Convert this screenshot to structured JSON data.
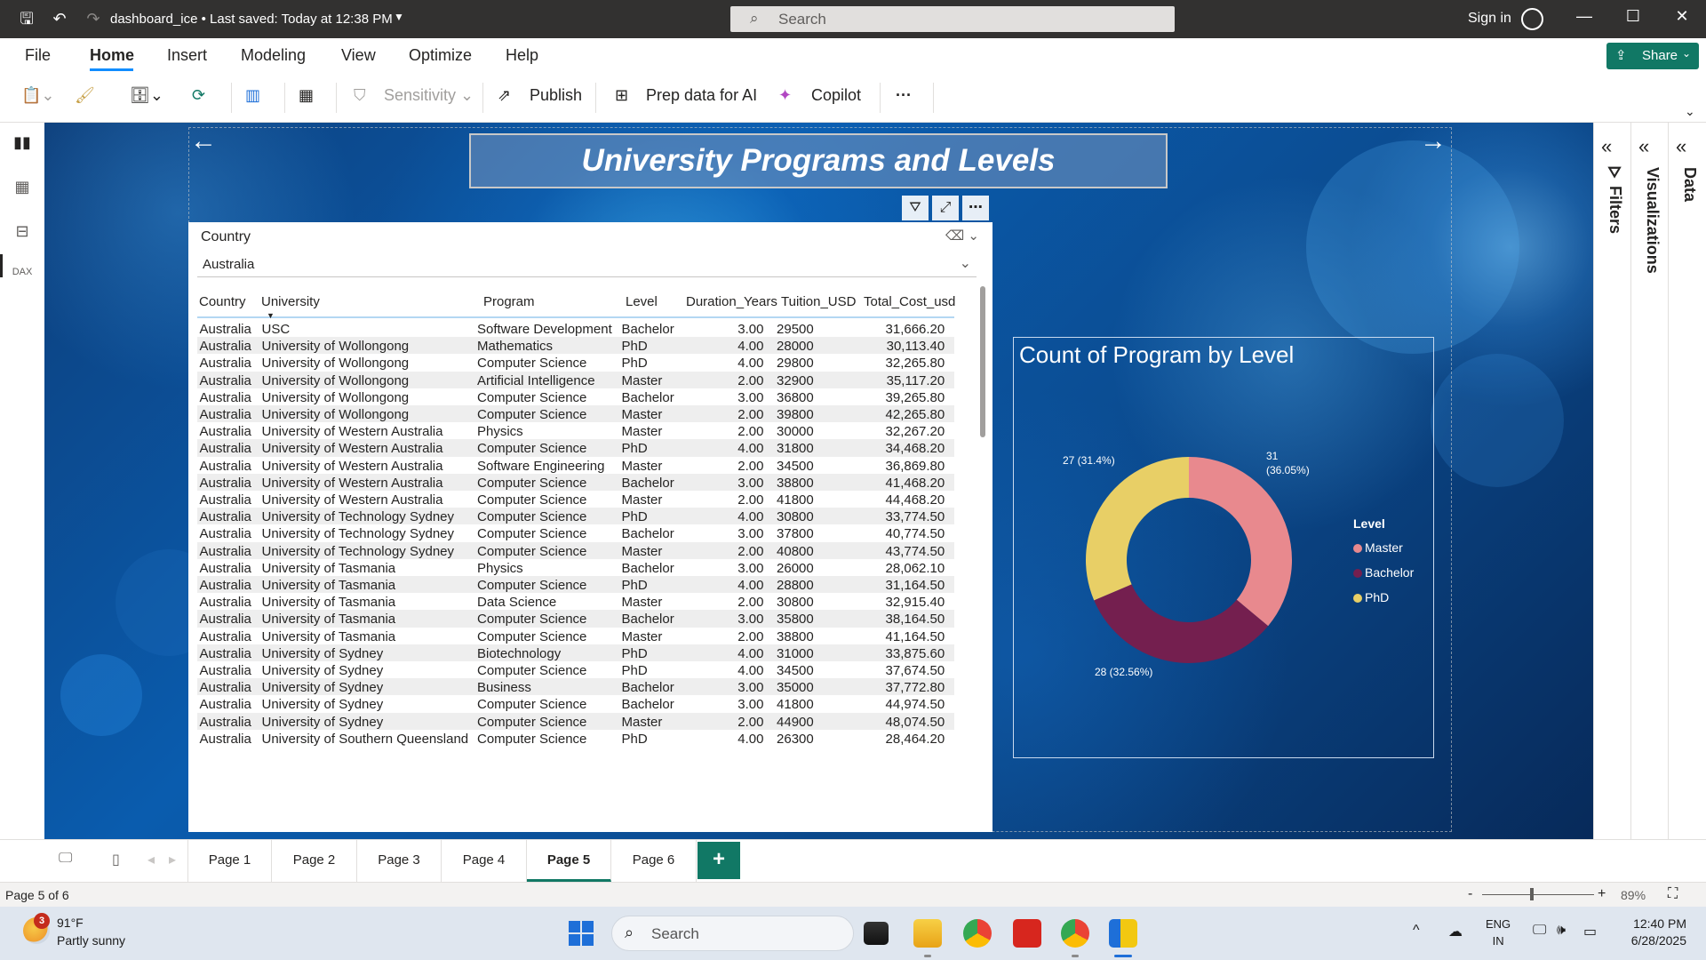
{
  "titlebar": {
    "doc_name": "dashboard_ice",
    "save_status": "Last saved: Today at 12:38 PM",
    "search_placeholder": "Search",
    "sign_in": "Sign in"
  },
  "menu": {
    "items": [
      "File",
      "Home",
      "Insert",
      "Modeling",
      "View",
      "Optimize",
      "Help"
    ],
    "active": "Home",
    "share": "Share"
  },
  "ribbon": {
    "sensitivity": "Sensitivity",
    "publish": "Publish",
    "prep_data": "Prep data for AI",
    "copilot": "Copilot",
    "more": "···"
  },
  "report": {
    "title": "University Programs and Levels"
  },
  "slicer": {
    "title": "Country",
    "selected": "Australia"
  },
  "table": {
    "columns": [
      "Country",
      "University",
      "Program",
      "Level",
      "Duration_Years",
      "Tuition_USD",
      "Total_Cost_usd"
    ],
    "rows": [
      [
        "Australia",
        "USC",
        "Software Development",
        "Bachelor",
        "3.00",
        "29500",
        "31,666.20"
      ],
      [
        "Australia",
        "University of Wollongong",
        "Mathematics",
        "PhD",
        "4.00",
        "28000",
        "30,113.40"
      ],
      [
        "Australia",
        "University of Wollongong",
        "Computer Science",
        "PhD",
        "4.00",
        "29800",
        "32,265.80"
      ],
      [
        "Australia",
        "University of Wollongong",
        "Artificial Intelligence",
        "Master",
        "2.00",
        "32900",
        "35,117.20"
      ],
      [
        "Australia",
        "University of Wollongong",
        "Computer Science",
        "Bachelor",
        "3.00",
        "36800",
        "39,265.80"
      ],
      [
        "Australia",
        "University of Wollongong",
        "Computer Science",
        "Master",
        "2.00",
        "39800",
        "42,265.80"
      ],
      [
        "Australia",
        "University of Western Australia",
        "Physics",
        "Master",
        "2.00",
        "30000",
        "32,267.20"
      ],
      [
        "Australia",
        "University of Western Australia",
        "Computer Science",
        "PhD",
        "4.00",
        "31800",
        "34,468.20"
      ],
      [
        "Australia",
        "University of Western Australia",
        "Software Engineering",
        "Master",
        "2.00",
        "34500",
        "36,869.80"
      ],
      [
        "Australia",
        "University of Western Australia",
        "Computer Science",
        "Bachelor",
        "3.00",
        "38800",
        "41,468.20"
      ],
      [
        "Australia",
        "University of Western Australia",
        "Computer Science",
        "Master",
        "2.00",
        "41800",
        "44,468.20"
      ],
      [
        "Australia",
        "University of Technology Sydney",
        "Computer Science",
        "PhD",
        "4.00",
        "30800",
        "33,774.50"
      ],
      [
        "Australia",
        "University of Technology Sydney",
        "Computer Science",
        "Bachelor",
        "3.00",
        "37800",
        "40,774.50"
      ],
      [
        "Australia",
        "University of Technology Sydney",
        "Computer Science",
        "Master",
        "2.00",
        "40800",
        "43,774.50"
      ],
      [
        "Australia",
        "University of Tasmania",
        "Physics",
        "Bachelor",
        "3.00",
        "26000",
        "28,062.10"
      ],
      [
        "Australia",
        "University of Tasmania",
        "Computer Science",
        "PhD",
        "4.00",
        "28800",
        "31,164.50"
      ],
      [
        "Australia",
        "University of Tasmania",
        "Data Science",
        "Master",
        "2.00",
        "30800",
        "32,915.40"
      ],
      [
        "Australia",
        "University of Tasmania",
        "Computer Science",
        "Bachelor",
        "3.00",
        "35800",
        "38,164.50"
      ],
      [
        "Australia",
        "University of Tasmania",
        "Computer Science",
        "Master",
        "2.00",
        "38800",
        "41,164.50"
      ],
      [
        "Australia",
        "University of Sydney",
        "Biotechnology",
        "PhD",
        "4.00",
        "31000",
        "33,875.60"
      ],
      [
        "Australia",
        "University of Sydney",
        "Computer Science",
        "PhD",
        "4.00",
        "34500",
        "37,674.50"
      ],
      [
        "Australia",
        "University of Sydney",
        "Business",
        "Bachelor",
        "3.00",
        "35000",
        "37,772.80"
      ],
      [
        "Australia",
        "University of Sydney",
        "Computer Science",
        "Bachelor",
        "3.00",
        "41800",
        "44,974.50"
      ],
      [
        "Australia",
        "University of Sydney",
        "Computer Science",
        "Master",
        "2.00",
        "44900",
        "48,074.50"
      ],
      [
        "Australia",
        "University of Southern Queensland",
        "Computer Science",
        "PhD",
        "4.00",
        "26300",
        "28,464.20"
      ]
    ]
  },
  "chart_data": {
    "type": "pie",
    "title": "Count of Program by Level",
    "legend_title": "Level",
    "legend_position": "right",
    "categories": [
      "Master",
      "Bachelor",
      "PhD"
    ],
    "values": [
      31,
      28,
      27
    ],
    "labels": [
      "31 (36.05%)",
      "28 (32.56%)",
      "27 (31.4%)"
    ],
    "colors": [
      "#e8898e",
      "#741f4f",
      "#e8cf66"
    ]
  },
  "panes": {
    "filters": "Filters",
    "visualizations": "Visualizations",
    "data": "Data"
  },
  "pages": {
    "tabs": [
      "Page 1",
      "Page 2",
      "Page 3",
      "Page 4",
      "Page 5",
      "Page 6"
    ],
    "active": "Page 5",
    "add": "+"
  },
  "status": {
    "page_info": "Page 5 of 6",
    "zoom": "89%"
  },
  "taskbar": {
    "weather_badge": "3",
    "weather_temp": "91°F",
    "weather_desc": "Partly sunny",
    "search": "Search",
    "lang_1": "ENG",
    "lang_2": "IN",
    "time": "12:40 PM",
    "date": "6/28/2025"
  },
  "colors": {
    "accent_green": "#117865",
    "accent_blue": "#118dff"
  }
}
